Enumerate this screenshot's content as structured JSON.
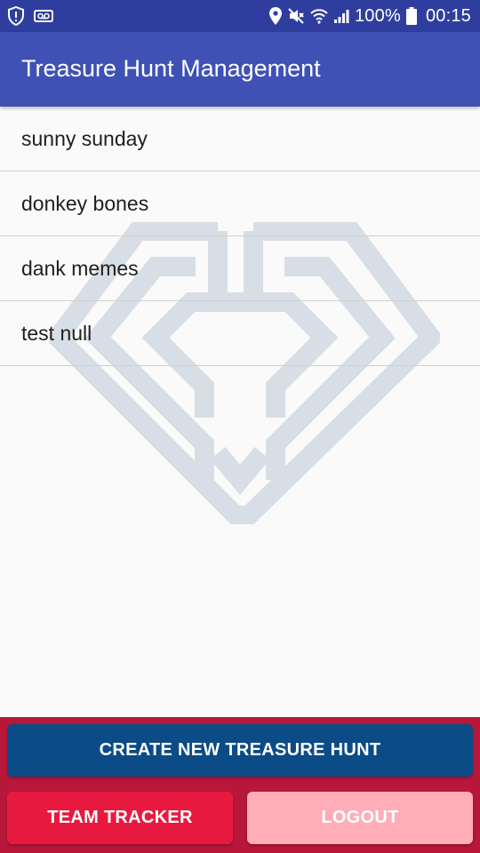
{
  "status_bar": {
    "battery_percent": "100%",
    "time": "00:15",
    "left_icons": [
      "shield-alert-icon",
      "voicemail-icon"
    ],
    "right_icons": [
      "location-pin-icon",
      "mute-icon",
      "wifi-icon",
      "signal-icon",
      "battery-icon"
    ]
  },
  "app_bar": {
    "title": "Treasure Hunt Management",
    "color": "#3f51b5"
  },
  "hunts": [
    {
      "name": "sunny sunday"
    },
    {
      "name": "donkey bones"
    },
    {
      "name": "dank memes"
    },
    {
      "name": "test null"
    }
  ],
  "watermark": {
    "icon": "diamond-logo-icon"
  },
  "actions": {
    "create_label": "CREATE NEW TREASURE HUNT",
    "team_tracker_label": "TEAM TRACKER",
    "logout_label": "LOGOUT"
  },
  "colors": {
    "status_bar": "#2f3e9e",
    "bottom_panel": "#b9173a",
    "create_button": "#0b4b86",
    "team_tracker_button": "#e8193f",
    "logout_button": "#ffadb8"
  }
}
